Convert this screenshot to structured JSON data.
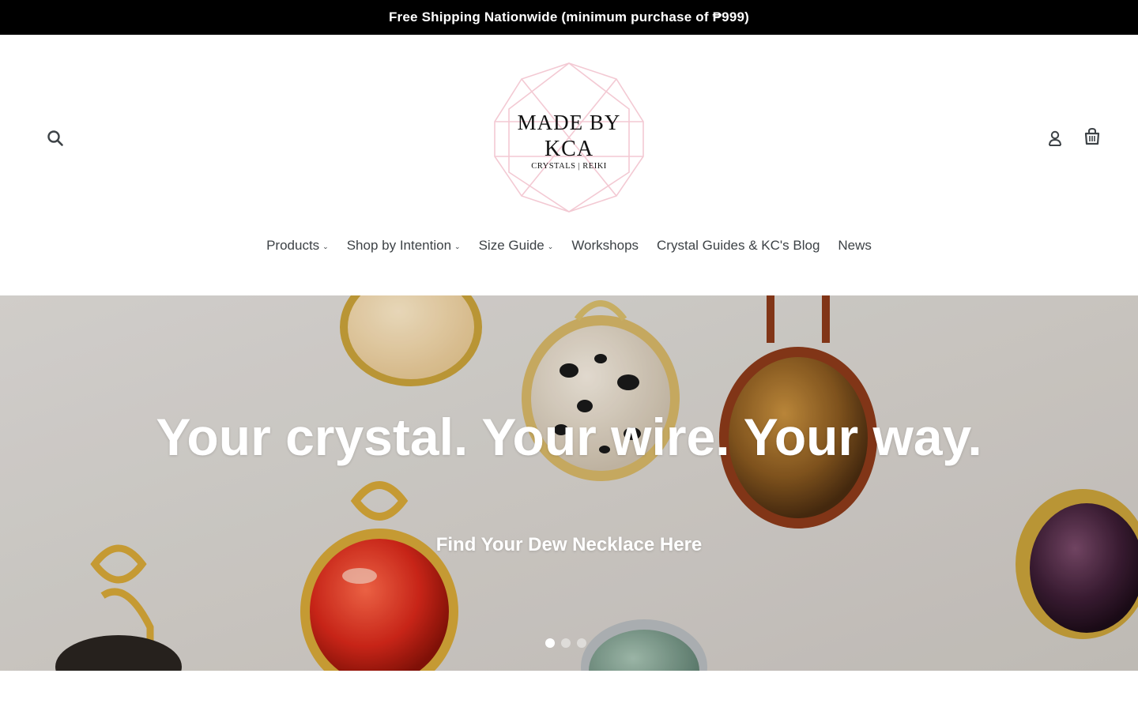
{
  "announcement": {
    "text": "Free Shipping Nationwide (minimum purchase of ₱999)"
  },
  "header": {
    "search_icon": "search-icon",
    "login_icon": "user-icon",
    "cart_icon": "cart-icon",
    "logo": {
      "line1": "MADE BY",
      "line2": "KCA",
      "line3": "CRYSTALS | REIKI"
    }
  },
  "nav": {
    "items": [
      {
        "label": "Products",
        "has_dropdown": true
      },
      {
        "label": "Shop by Intention",
        "has_dropdown": true
      },
      {
        "label": "Size Guide",
        "has_dropdown": true
      },
      {
        "label": "Workshops",
        "has_dropdown": false
      },
      {
        "label": "Crystal Guides & KC's Blog",
        "has_dropdown": false
      },
      {
        "label": "News",
        "has_dropdown": false
      }
    ],
    "caret": "⌄"
  },
  "hero": {
    "title": "Your crystal. Your wire. Your way.",
    "subtitle": "Find Your Dew Necklace Here",
    "slide_count": 3,
    "active_slide": 1
  },
  "colors": {
    "announcement_bg": "#000000",
    "text": "#3d4246",
    "logo_accent": "#f3c9d3"
  }
}
